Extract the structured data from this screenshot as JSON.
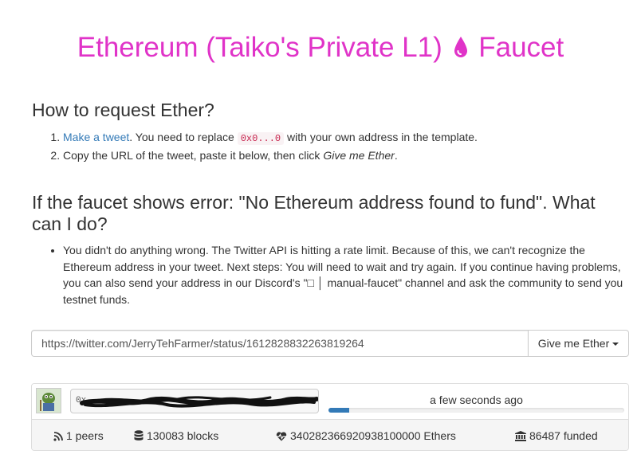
{
  "header": {
    "title_left": "Ethereum (Taiko's Private L1)",
    "title_right": "Faucet",
    "title_color": "#e033c8",
    "icon": "tint-drop-icon"
  },
  "howto": {
    "heading": "How to request Ether?",
    "step1_link": "Make a tweet",
    "step1_before_code": ". You need to replace ",
    "step1_code": "0x0...0",
    "step1_after_code": " with your own address in the template.",
    "step2_text": "Copy the URL of the tweet, paste it below, then click ",
    "step2_em": "Give me Ether",
    "step2_end": "."
  },
  "error_help": {
    "heading": "If the faucet shows error: \"No Ethereum address found to fund\". What can I do?",
    "bullet": "You didn't do anything wrong. The Twitter API is hitting a rate limit. Because of this, we can't recognize the Ethereum address in your tweet. Next steps: You will need to wait and try again. If you continue having problems, you can also send your address in our Discord's \"□ │ manual-faucet\" channel and ask the community to send you testnet funds."
  },
  "request_form": {
    "url_value": "https://twitter.com/JerryTehFarmer/status/1612828832263819264",
    "button_label": "Give me Ether"
  },
  "request_panel": {
    "address_text": "0x",
    "time_label": "a few seconds ago",
    "progress_fraction": 0.07,
    "accent": "#337ab7"
  },
  "stats": {
    "peers": "1 peers",
    "blocks": "130083 blocks",
    "ethers": "340282366920938100000 Ethers",
    "funded": "86487 funded"
  }
}
